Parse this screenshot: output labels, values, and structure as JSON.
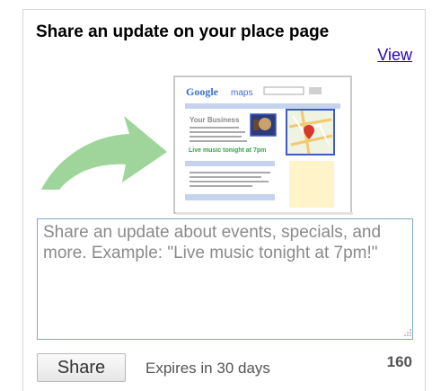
{
  "header": {
    "title": "Share an update on your place page",
    "view_link": "View"
  },
  "illustration": {
    "brand_word": "Google",
    "product_word": "maps",
    "business_name": "Your Business",
    "featured_update": "Live music tonight at 7pm"
  },
  "update": {
    "placeholder": "Share an update about events, specials, and more. Example: \"Live music tonight at 7pm!\""
  },
  "footer": {
    "share_label": "Share",
    "expires_text": "Expires in 30 days",
    "char_count": "160"
  },
  "colors": {
    "arrow": "#9fd59a",
    "link": "#2200cc",
    "input_border": "#7fa7cf",
    "page_accent": "#c6d3ef",
    "map_highlight": "#3c5bc9",
    "note_fill": "#fff3c9"
  }
}
